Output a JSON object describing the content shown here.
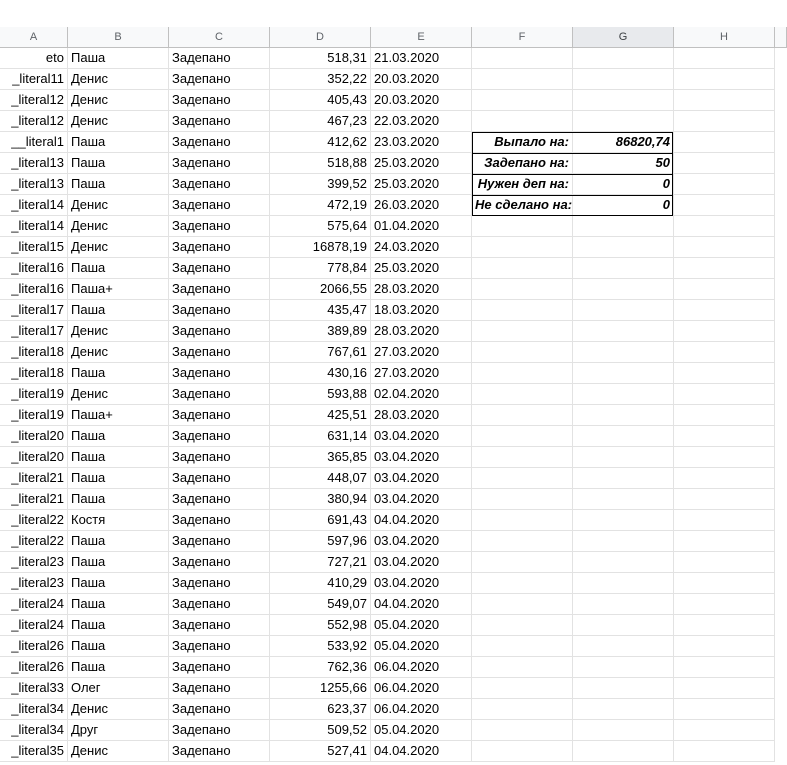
{
  "columns": [
    "A",
    "B",
    "C",
    "D",
    "E",
    "F",
    "G",
    "H"
  ],
  "selected_column": "G",
  "rows": [
    {
      "a": "eto",
      "b": "Паша",
      "c": "Задепано",
      "d": "518,31",
      "e": "21.03.2020"
    },
    {
      "a": "_literal11",
      "b": "Денис",
      "c": "Задепано",
      "d": "352,22",
      "e": "20.03.2020"
    },
    {
      "a": "_literal12",
      "b": "Денис",
      "c": "Задепано",
      "d": "405,43",
      "e": "20.03.2020"
    },
    {
      "a": "_literal12",
      "b": "Денис",
      "c": "Задепано",
      "d": "467,23",
      "e": "22.03.2020"
    },
    {
      "a": "__literal1",
      "b": "Паша",
      "c": "Задепано",
      "d": "412,62",
      "e": "23.03.2020"
    },
    {
      "a": "_literal13",
      "b": "Паша",
      "c": "Задепано",
      "d": "518,88",
      "e": "25.03.2020"
    },
    {
      "a": "_literal13",
      "b": "Паша",
      "c": "Задепано",
      "d": "399,52",
      "e": "25.03.2020"
    },
    {
      "a": "_literal14",
      "b": "Денис",
      "c": "Задепано",
      "d": "472,19",
      "e": "26.03.2020"
    },
    {
      "a": "_literal14",
      "b": "Денис",
      "c": "Задепано",
      "d": "575,64",
      "e": "01.04.2020"
    },
    {
      "a": "_literal15",
      "b": "Денис",
      "c": "Задепано",
      "d": "16878,19",
      "e": "24.03.2020"
    },
    {
      "a": "_literal16",
      "b": "Паша",
      "c": "Задепано",
      "d": "778,84",
      "e": "25.03.2020"
    },
    {
      "a": "_literal16",
      "b": "Паша+",
      "c": "Задепано",
      "d": "2066,55",
      "e": "28.03.2020"
    },
    {
      "a": "_literal17",
      "b": "Паша",
      "c": "Задепано",
      "d": "435,47",
      "e": "18.03.2020"
    },
    {
      "a": "_literal17",
      "b": "Денис",
      "c": "Задепано",
      "d": "389,89",
      "e": "28.03.2020"
    },
    {
      "a": "_literal18",
      "b": "Денис",
      "c": "Задепано",
      "d": "767,61",
      "e": "27.03.2020"
    },
    {
      "a": "_literal18",
      "b": "Паша",
      "c": "Задепано",
      "d": "430,16",
      "e": "27.03.2020"
    },
    {
      "a": "_literal19",
      "b": "Денис",
      "c": "Задепано",
      "d": "593,88",
      "e": "02.04.2020"
    },
    {
      "a": "_literal19",
      "b": "Паша+",
      "c": "Задепано",
      "d": "425,51",
      "e": "28.03.2020"
    },
    {
      "a": "_literal20",
      "b": "Паша",
      "c": "Задепано",
      "d": "631,14",
      "e": "03.04.2020"
    },
    {
      "a": "_literal20",
      "b": "Паша",
      "c": "Задепано",
      "d": "365,85",
      "e": "03.04.2020"
    },
    {
      "a": "_literal21",
      "b": "Паша",
      "c": "Задепано",
      "d": "448,07",
      "e": "03.04.2020"
    },
    {
      "a": "_literal21",
      "b": "Паша",
      "c": "Задепано",
      "d": "380,94",
      "e": "03.04.2020"
    },
    {
      "a": "_literal22",
      "b": "Костя",
      "c": "Задепано",
      "d": "691,43",
      "e": "04.04.2020"
    },
    {
      "a": "_literal22",
      "b": "Паша",
      "c": "Задепано",
      "d": "597,96",
      "e": "03.04.2020"
    },
    {
      "a": "_literal23",
      "b": "Паша",
      "c": "Задепано",
      "d": "727,21",
      "e": "03.04.2020"
    },
    {
      "a": "_literal23",
      "b": "Паша",
      "c": "Задепано",
      "d": "410,29",
      "e": "03.04.2020"
    },
    {
      "a": "_literal24",
      "b": "Паша",
      "c": "Задепано",
      "d": "549,07",
      "e": "04.04.2020"
    },
    {
      "a": "_literal24",
      "b": "Паша",
      "c": "Задепано",
      "d": "552,98",
      "e": "05.04.2020"
    },
    {
      "a": "_literal26",
      "b": "Паша",
      "c": "Задепано",
      "d": "533,92",
      "e": "05.04.2020"
    },
    {
      "a": "_literal26",
      "b": "Паша",
      "c": "Задепано",
      "d": "762,36",
      "e": "06.04.2020"
    },
    {
      "a": "_literal33",
      "b": "Олег",
      "c": "Задепано",
      "d": "1255,66",
      "e": "06.04.2020"
    },
    {
      "a": "_literal34",
      "b": "Денис",
      "c": "Задепано",
      "d": "623,37",
      "e": "06.04.2020"
    },
    {
      "a": "_literal34",
      "b": "Друг",
      "c": "Задепано",
      "d": "509,52",
      "e": "05.04.2020"
    },
    {
      "a": "_literal35",
      "b": "Денис",
      "c": "Задепано",
      "d": "527,41",
      "e": "04.04.2020"
    }
  ],
  "summary": [
    {
      "label": "Выпало на:",
      "value": "86820,74"
    },
    {
      "label": "Задепано на:",
      "value": "50"
    },
    {
      "label": "Нужен деп на:",
      "value": "0"
    },
    {
      "label": "Не сделано на:",
      "value": "0"
    }
  ]
}
